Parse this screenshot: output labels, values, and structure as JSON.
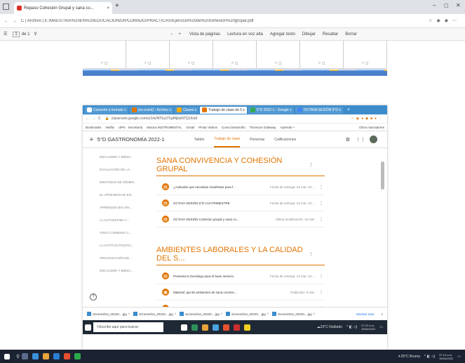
{
  "outer_browser": {
    "tab_title": "Repaso Cohesión Grupal y sana co...",
    "url": "C  |  Archivo  |  E:/MAESTRÍA%20EN%20EDUCACIÓN/DIPLOMADO/PRACTICAS/Ejercicio%20de%20cohesion%20grupal.pdf",
    "toolbar": {
      "page_left": "1",
      "page_of": "de 1",
      "zoom_minus": "−",
      "zoom_plus": "+",
      "fit": "Vista de páginas",
      "read_aloud": "Lectura en voz alta",
      "add_text": "Agregar texto",
      "draw": "Dibujar",
      "highlight": "Resaltar",
      "erase": "Borrar"
    }
  },
  "pdf": {
    "cells": [
      "✓ ◻",
      "✓ ◻",
      "✓ ◻",
      "✓ ◻",
      "✓ ◻",
      "✓ ◻",
      "✓ ◻"
    ]
  },
  "inner_browser": {
    "tabs": [
      {
        "label": "Convertir a formato x",
        "active": false,
        "color": "#3c8ccc"
      },
      {
        "label": "(no event) - Archivo x",
        "active": false,
        "color": "#e37400"
      },
      {
        "label": "Clases x",
        "active": false,
        "color": "#f9ab00"
      },
      {
        "label": "Trabajo de clase de 5 x",
        "active": true,
        "color": "#e37400"
      },
      {
        "label": "5°D 2022-1 - Google x",
        "active": false,
        "color": "#34a853"
      },
      {
        "label": "OCTAVA SESIÓN 5°D x",
        "active": false,
        "color": "#4285f4"
      }
    ],
    "url": "classroom.google.com/u/1/w/NTEyOTg4NjIwNTQ1/t/all",
    "bookmarks": [
      "Bookmarks",
      "Netflix",
      "UPN · Secretaría",
      "Música INSTRUMENTAL",
      "Gmail",
      "Pintar Videos",
      "Curso Desarrollo",
      "Thomson Gateway",
      "Aprende +"
    ],
    "bookmarks_right": "Otros marcadores",
    "class_title": "5°D GASTRONOMÍA 2022-1",
    "nav": [
      "Tablón",
      "Trabajo de clase",
      "Personas",
      "Calificaciones"
    ],
    "sidebar": [
      "ENCUADRE Y BIENV...",
      "EVALUACIÓN DE LA...",
      "IDENTIDAD DE GÉNER...",
      "EL APRENDIZAJE EN...",
      "APRENDIZAJES A/N...",
      "LA AUTOESTIMA Y...",
      "TODO COMIENZA C...",
      "LA ACTITUD POSITIV...",
      "ORGANIZACIÓN DE...",
      "ENCUADRE Y BIENV..."
    ],
    "topics": [
      {
        "title": "SANA CONVIVENCIA Y COHESIÓN GRUPAL",
        "items": [
          {
            "title": "¿Actitudes que necesitas manifestar para f...",
            "due": "Fecha de entrega: 23 mar. 23:..."
          },
          {
            "title": "OCTAVA SESIÓN 5°D CUATRIMESTRE",
            "due": "Fecha de entrega: 23 mar. 23:..."
          },
          {
            "title": "OCTAVA SESIÓN Cohesión grupal y sana co...",
            "due": "Última modificación: 16 mar."
          }
        ]
      },
      {
        "title": "AMBIENTES LABORALES Y LA CALIDAD DEL S...",
        "items": [
          {
            "title": "Presenta tu Decálogo para el buen servicio.",
            "due": "Fecha de entrega: 13 mar. 23:..."
          },
          {
            "title": "Material: ppt de ambientes de sana convive...",
            "due": "Publicado: 9 mar."
          },
          {
            "title": "SÉPTIMA SESIÓN 5°D CUATRIMESTRE",
            "due": "Fecha de entrega: 16 mar. 23:..."
          }
        ]
      }
    ],
    "help": "?",
    "downloads": [
      "Screenshot_20220....jpg",
      "Screenshot_20220....jpg",
      "Screenshot_20220....jpg",
      "Screenshot_20220....jpg",
      "Screenshot_20220....jpg"
    ],
    "downloads_show_all": "Mostrar todo",
    "taskbar_search": "Escribe aquí para buscar",
    "taskbar_weather": "23°C Nublado",
    "taskbar_time": "07:13 a.m.",
    "taskbar_date": "30/04/2022"
  },
  "taskbar": {
    "weather": "25°C Bruma",
    "time": "07:14 a.m.",
    "date": "30/04/2022"
  },
  "colors": {
    "accent": "#e37400",
    "chrome_blue": "#3c8ccc",
    "taskbar": "#1b2333"
  }
}
